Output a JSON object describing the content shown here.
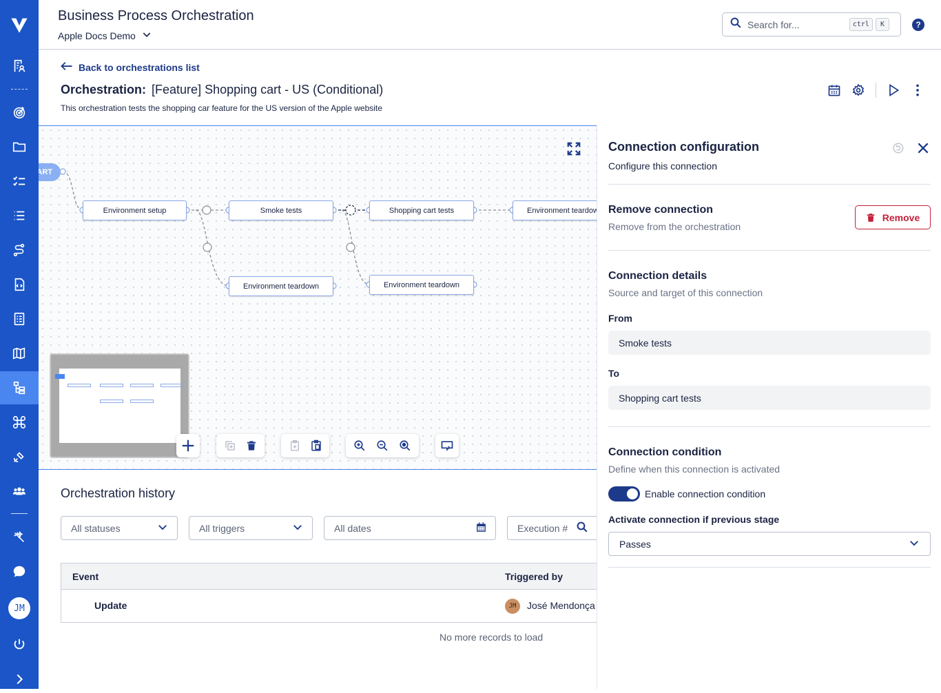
{
  "header": {
    "app_title": "Business Process Orchestration",
    "project": "Apple Docs Demo",
    "search_placeholder": "Search for...",
    "shortcut_keys": [
      "ctrl",
      "K"
    ],
    "help_label": "?"
  },
  "user": {
    "initials": "JM",
    "avatar_color": "#ffffff"
  },
  "colors": {
    "sidebar": "#1b55c7",
    "sidebar_active": "#4a86f0",
    "primary": "#1d3a8a",
    "danger": "#c4203b"
  },
  "sidebar": {
    "icons": [
      "logo-icon",
      "test-repository-icon",
      "target-icon",
      "folder-icon",
      "checklist-icon",
      "list-icon",
      "route-icon",
      "document-code-icon",
      "report-icon",
      "map-icon",
      "orchestration-icon",
      "command-icon",
      "satellite-icon",
      "users-icon",
      "magic-icon",
      "chat-icon",
      "power-icon",
      "expand-icon"
    ],
    "active": "orchestration-icon"
  },
  "page": {
    "back_link": "Back to orchestrations list",
    "title_prefix": "Orchestration:",
    "title": "[Feature] Shopping cart - US (Conditional)",
    "description": "This orchestration tests the shopping car feature for the US version of the Apple website"
  },
  "canvas": {
    "start_label": "ART",
    "nodes": [
      "Environment setup",
      "Smoke tests",
      "Shopping cart tests",
      "Environment teardown",
      "Environment teardown",
      "Environment teardown"
    ]
  },
  "history": {
    "title": "Orchestration history",
    "filters": {
      "statuses": "All statuses",
      "triggers": "All triggers",
      "dates": "All dates",
      "execution": "Execution #"
    },
    "columns": {
      "event": "Event",
      "triggered_by": "Triggered by"
    },
    "rows": [
      {
        "event": "Update",
        "user_initials": "JM",
        "user_name": "José Mendonça"
      }
    ],
    "footer": "No more records to load"
  },
  "panel": {
    "title": "Connection configuration",
    "subtitle": "Configure this connection",
    "remove": {
      "title": "Remove connection",
      "subtitle": "Remove from the orchestration",
      "button": "Remove"
    },
    "details": {
      "title": "Connection details",
      "subtitle": "Source and target of this connection",
      "from_label": "From",
      "from_value": "Smoke tests",
      "to_label": "To",
      "to_value": "Shopping cart tests"
    },
    "condition": {
      "title": "Connection condition",
      "subtitle": "Define when this connection is activated",
      "toggle_label": "Enable connection condition",
      "toggle_on": true,
      "select_label": "Activate connection if previous stage",
      "select_value": "Passes"
    }
  }
}
